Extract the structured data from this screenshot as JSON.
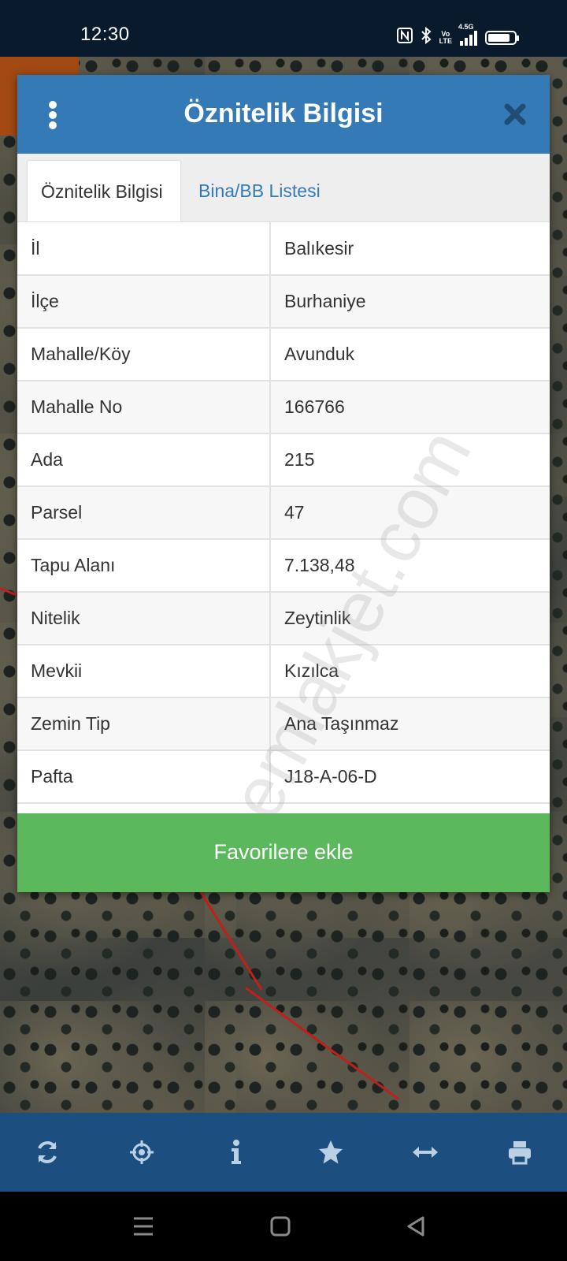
{
  "status_bar": {
    "time": "12:30",
    "icons": [
      "nfc-icon",
      "bluetooth-icon",
      "volte-icon",
      "signal-icon",
      "battery-icon"
    ],
    "volte_text": [
      "Vo",
      "LTE"
    ],
    "network_text": "4.5G",
    "battery_level": 0.85
  },
  "dialog": {
    "title": "Öznitelik Bilgisi",
    "tabs": [
      {
        "label": "Öznitelik Bilgisi",
        "active": true
      },
      {
        "label": "Bina/BB Listesi",
        "active": false
      }
    ],
    "rows": [
      {
        "key": "İl",
        "value": "Balıkesir"
      },
      {
        "key": "İlçe",
        "value": "Burhaniye"
      },
      {
        "key": "Mahalle/Köy",
        "value": "Avunduk"
      },
      {
        "key": "Mahalle No",
        "value": "166766"
      },
      {
        "key": "Ada",
        "value": "215"
      },
      {
        "key": "Parsel",
        "value": "47"
      },
      {
        "key": "Tapu Alanı",
        "value": "7.138,48"
      },
      {
        "key": "Nitelik",
        "value": "Zeytinlik"
      },
      {
        "key": "Mevkii",
        "value": "Kızılca"
      },
      {
        "key": "Zemin Tip",
        "value": "Ana Taşınmaz"
      },
      {
        "key": "Pafta",
        "value": "J18-A-06-D"
      }
    ],
    "favorite_button": "Favorilere ekle"
  },
  "watermark": "emlakjet.com",
  "toolbar": {
    "items": [
      "refresh-icon",
      "locate-icon",
      "info-icon",
      "star-icon",
      "measure-icon",
      "print-icon"
    ]
  },
  "colors": {
    "header": "#337ab7",
    "button": "#5cb85c",
    "toolbar": "#1c4f80",
    "status_bar": "#081a2c"
  }
}
